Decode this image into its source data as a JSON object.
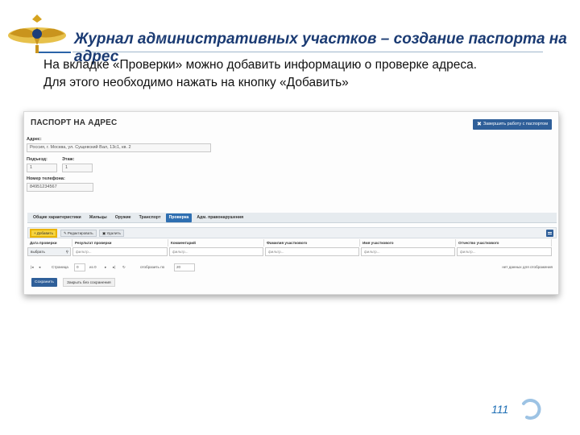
{
  "slide": {
    "title": "Журнал административных участков – создание паспорта на адрес",
    "body_line1": "На вкладке «Проверки» можно добавить информацию о проверке адреса.",
    "body_line2": "Для этого необходимо нажать на кнопку «Добавить»",
    "page_number": "111"
  },
  "app": {
    "title": "ПАСПОРТ НА АДРЕС",
    "finish_button": "Завершить работу с паспортом",
    "fields": {
      "address_label": "Адрес:",
      "address_value": "Россия, г. Москва, ул. Сущевский Вал, 13с1, кв. 2",
      "entrance_label": "Подъезд:",
      "entrance_value": "1",
      "floor_label": "Этаж:",
      "floor_value": "1",
      "phone_label": "Номер телефона:",
      "phone_value": "84951234567"
    },
    "tabs": [
      {
        "label": "Общие характеристики",
        "active": false
      },
      {
        "label": "Жильцы",
        "active": false
      },
      {
        "label": "Оружие",
        "active": false
      },
      {
        "label": "Транспорт",
        "active": false
      },
      {
        "label": "Проверка",
        "active": true
      },
      {
        "label": "Адм. правонарушения",
        "active": false
      }
    ],
    "toolbar": {
      "add": "Добавить",
      "edit": "Редактировать",
      "delete": "Удалить"
    },
    "grid": {
      "columns": [
        "Дата проверки",
        "Результат проверки",
        "Комментарий",
        "Фамилия участкового",
        "Имя участкового",
        "Отчество участкового"
      ],
      "first_filter": "выбрать",
      "filter_placeholder": "фильтр..."
    },
    "pager": {
      "page_label": "Страница",
      "page_value": "0",
      "of_label": "из 0",
      "show_label": "отобразить по",
      "page_size": "20",
      "empty_text": "нет данных для отображения"
    },
    "save_button": "Сохранить",
    "close_button": "Закрыть без сохранения"
  },
  "colors": {
    "accent": "#2f5f99",
    "highlight": "#f6d33f",
    "title_text": "#1b3b73",
    "page_number": "#1f6fb5"
  }
}
